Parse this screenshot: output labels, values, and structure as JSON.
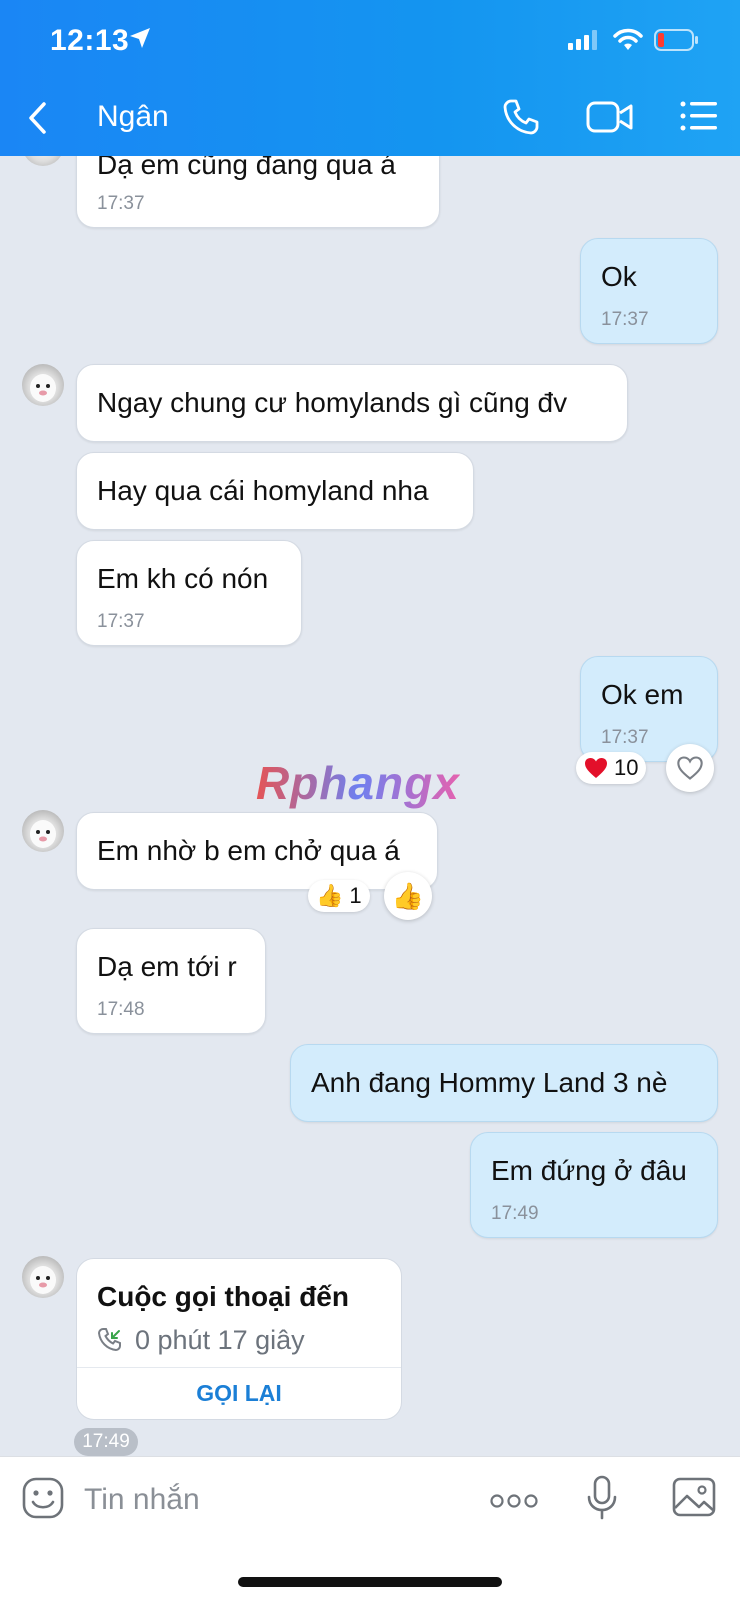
{
  "status_bar": {
    "time": "12:13"
  },
  "header": {
    "contact_name": "Ngân"
  },
  "messages": [
    {
      "text": "Dạ em cũng đang qua á",
      "time": "17:37"
    },
    {
      "text": "Ok",
      "time": "17:37"
    },
    {
      "text": "Ngay chung cư homylands gì cũng đv"
    },
    {
      "text": "Hay qua cái homyland nha"
    },
    {
      "text": "Em kh có nón",
      "time": "17:37"
    },
    {
      "text": "Ok em",
      "time": "17:37",
      "reaction_count": "10"
    },
    {
      "text": "Em nhờ b em chở qua á",
      "reaction_count": "1"
    },
    {
      "text": "Dạ em tới r",
      "time": "17:48"
    },
    {
      "text": "Anh đang Hommy Land 3 nè"
    },
    {
      "text": "Em đứng ở đâu",
      "time": "17:49"
    }
  ],
  "watermark": "Rphangx",
  "call_card": {
    "title": "Cuộc gọi thoại đến",
    "duration": "0 phút 17 giây",
    "action": "GỌI LẠI",
    "time": "17:49"
  },
  "composer": {
    "placeholder": "Tin nhắn"
  },
  "colors": {
    "header_blue": "#1a86f5",
    "outgoing_bubble": "#d3ecfc",
    "incoming_bubble": "#ffffff",
    "background": "#e3e8f0",
    "link_blue": "#1b7fd6"
  },
  "icons": [
    "location-arrow-icon",
    "signal-icon",
    "wifi-icon",
    "battery-icon",
    "back-icon",
    "phone-icon",
    "video-icon",
    "menu-icon",
    "heart-icon",
    "thumbs-up-icon",
    "incoming-call-icon",
    "emoji-icon",
    "more-icon",
    "mic-icon",
    "image-icon"
  ]
}
